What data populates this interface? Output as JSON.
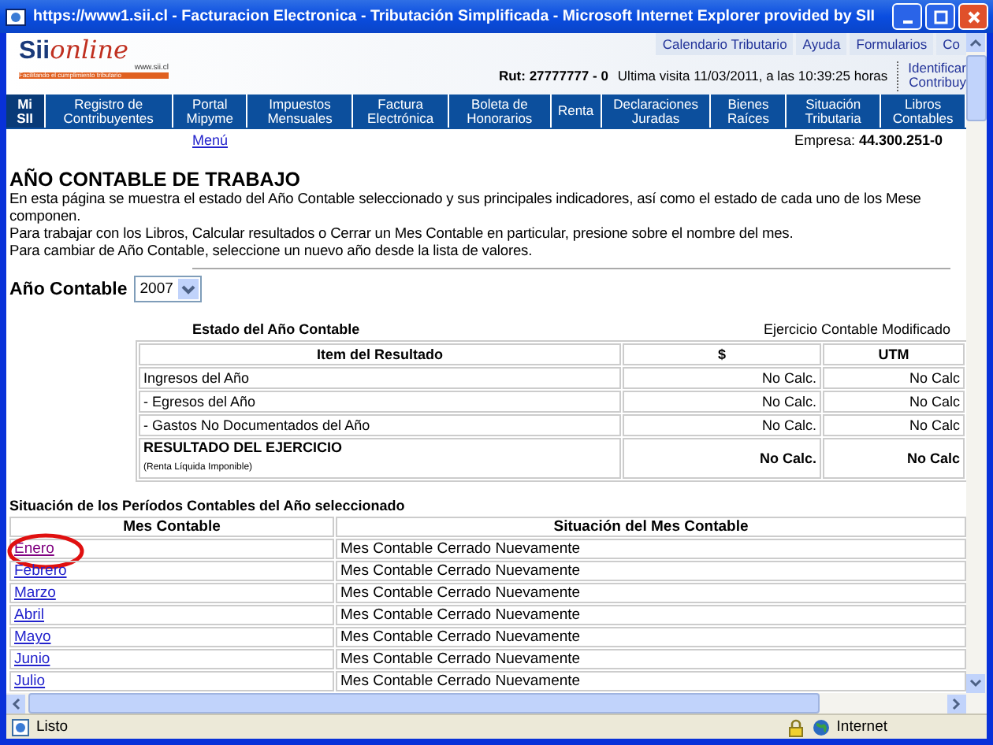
{
  "window": {
    "title": "https://www1.sii.cl - Facturacion Electronica - Tributación Simplificada - Microsoft Internet Explorer provided by SII"
  },
  "top_links": [
    "Calendario Tributario",
    "Ayuda",
    "Formularios",
    "Co"
  ],
  "logo": {
    "text": "online",
    "brand": "Sii",
    "domain": "www.sii.cl",
    "tagline": "Facilitando el cumplimiento tributario"
  },
  "user_info": {
    "rut": "Rut: 27777777 - 0",
    "last_visit": "Ultima visita 11/03/2011, a las 10:39:25 horas"
  },
  "identify_link": [
    "Identificar",
    "Contribuy"
  ],
  "nav": [
    {
      "label": "Mi SII",
      "selected": true
    },
    {
      "label": "Registro de Contribuyentes",
      "selected": false
    },
    {
      "label": "Portal Mipyme",
      "selected": false
    },
    {
      "label": "Impuestos Mensuales",
      "selected": false
    },
    {
      "label": "Factura Electrónica",
      "selected": false
    },
    {
      "label": "Boleta de Honorarios",
      "selected": false
    },
    {
      "label": "Renta",
      "selected": false
    },
    {
      "label": "Declaraciones Juradas",
      "selected": false
    },
    {
      "label": "Bienes Raíces",
      "selected": false
    },
    {
      "label": "Situación Tributaria",
      "selected": false
    },
    {
      "label": "Libros Contables",
      "selected": false
    }
  ],
  "menu_link": "Menú",
  "empresa": {
    "label": "Empresa:",
    "value": "44.300.251-0"
  },
  "heading": "AÑO CONTABLE DE TRABAJO",
  "intro": [
    "En esta página se muestra el estado del Año Contable seleccionado y sus principales indicadores, así como el estado de cada uno de los Mese",
    "componen.",
    "Para trabajar con los Libros, Calcular resultados o Cerrar un Mes Contable en particular, presione sobre el nombre del mes.",
    "Para cambiar de Año Contable, seleccione un nuevo año desde la lista de valores."
  ],
  "year_select": {
    "label": "Año Contable",
    "value": "2007"
  },
  "status_table": {
    "title": "Estado del Año Contable",
    "status": "Ejercicio Contable Modificado",
    "columns": [
      "Item del Resultado",
      "$",
      "UTM"
    ],
    "rows": [
      {
        "item": "Ingresos del Año",
        "amount": "No Calc.",
        "utm": "No Calc",
        "total": false
      },
      {
        "item": "- Egresos del Año",
        "amount": "No Calc.",
        "utm": "No Calc",
        "total": false
      },
      {
        "item": "- Gastos No Documentados del Año",
        "amount": "No Calc.",
        "utm": "No Calc",
        "total": false
      },
      {
        "item": "RESULTADO DEL EJERCICIO",
        "note": "(Renta Líquida Imponible)",
        "amount": "No Calc.",
        "utm": "No Calc",
        "total": true
      }
    ]
  },
  "periods_table": {
    "title": "Situación de los Períodos Contables del Año seleccionado",
    "columns": [
      "Mes Contable",
      "Situación del Mes Contable"
    ],
    "rows": [
      {
        "month": "Enero",
        "status": "Mes Contable Cerrado Nuevamente",
        "visited": true,
        "circled": true
      },
      {
        "month": "Febrero",
        "status": "Mes Contable Cerrado Nuevamente",
        "visited": false,
        "circled": false
      },
      {
        "month": "Marzo",
        "status": "Mes Contable Cerrado Nuevamente",
        "visited": false,
        "circled": false
      },
      {
        "month": "Abril",
        "status": "Mes Contable Cerrado Nuevamente",
        "visited": false,
        "circled": false
      },
      {
        "month": "Mayo",
        "status": "Mes Contable Cerrado Nuevamente",
        "visited": false,
        "circled": false
      },
      {
        "month": "Junio",
        "status": "Mes Contable Cerrado Nuevamente",
        "visited": false,
        "circled": false
      },
      {
        "month": "Julio",
        "status": "Mes Contable Cerrado Nuevamente",
        "visited": false,
        "circled": false
      }
    ]
  },
  "status_bar": {
    "text": "Listo",
    "zone": "Internet"
  }
}
